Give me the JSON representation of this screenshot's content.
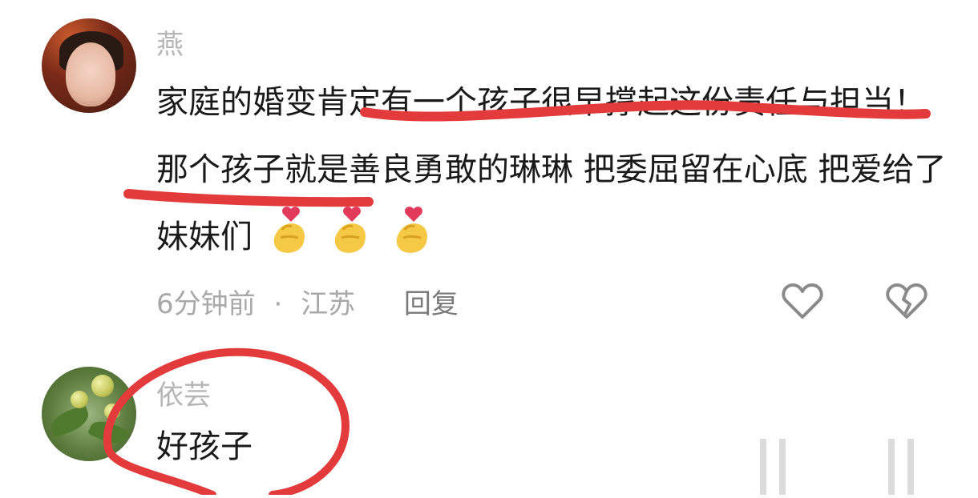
{
  "comments": [
    {
      "username": "燕",
      "text": "家庭的婚变肯定有一个孩子很早撑起这份责任与担当！那个孩子就是善良勇敢的琳琳 把委屈留在心底 把爱给了妹妹们",
      "emoji_icon": "finger-heart-emoji",
      "emoji_count": 3,
      "meta": {
        "time": "6分钟前",
        "separator": "·",
        "location": "江苏",
        "reply_label": "回复"
      },
      "icons": [
        "heart-outline-icon",
        "broken-heart-icon"
      ]
    },
    {
      "username": "依芸",
      "text": "好孩子"
    }
  ],
  "colors": {
    "annotation_red": "#e33b3b",
    "username_gray": "#b5b5b5",
    "text": "#1a1a1a",
    "meta_gray": "#a8a8a8"
  }
}
